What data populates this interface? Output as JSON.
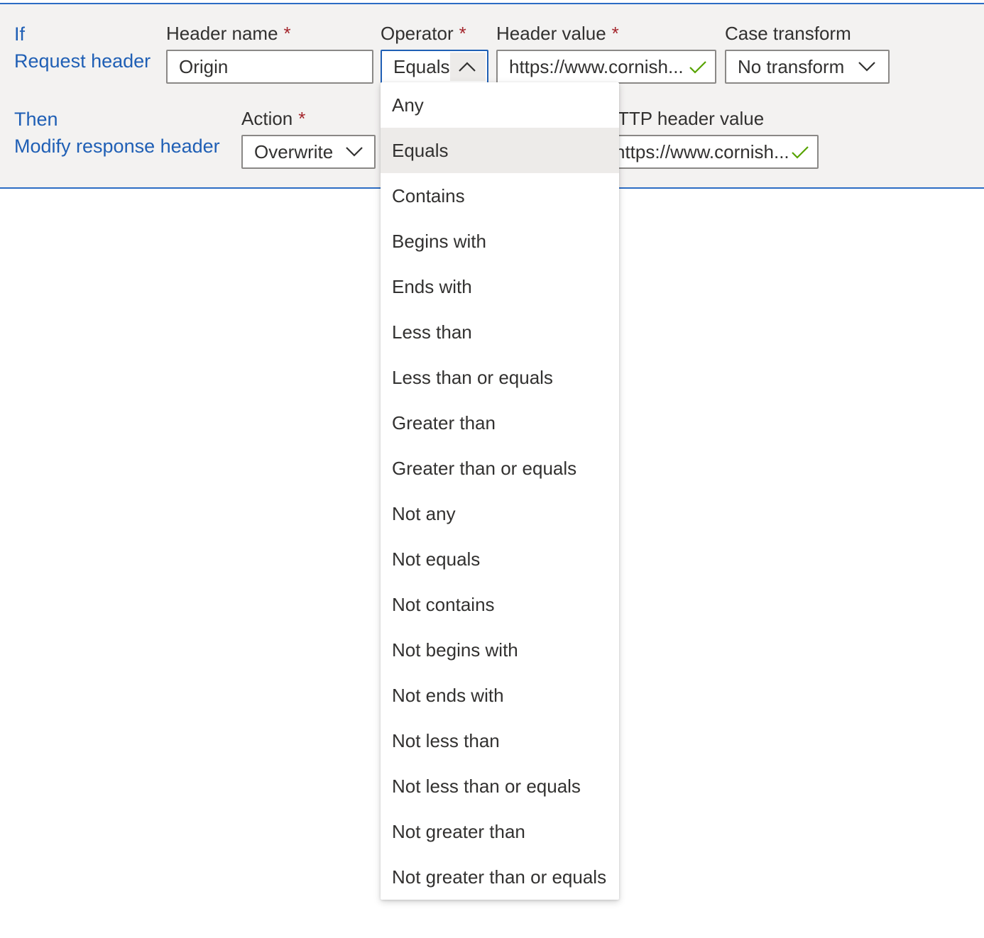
{
  "condition": {
    "keyword": "If",
    "type_label": "Request header",
    "header_name": {
      "label": "Header name",
      "required_mark": "*",
      "value": "Origin"
    },
    "operator": {
      "label": "Operator",
      "required_mark": "*",
      "value": "Equals"
    },
    "header_value": {
      "label": "Header value",
      "required_mark": "*",
      "value": "https://www.cornish..."
    },
    "case_transform": {
      "label": "Case transform",
      "value": "No transform"
    }
  },
  "action": {
    "keyword": "Then",
    "type_label": "Modify response header",
    "action_field": {
      "label": "Action",
      "required_mark": "*",
      "value": "Overwrite"
    },
    "http_header_value": {
      "label": "TTP header value",
      "value": "https://www.cornish..."
    }
  },
  "operator_dropdown": {
    "selected": "Equals",
    "options": [
      "Any",
      "Equals",
      "Contains",
      "Begins with",
      "Ends with",
      "Less than",
      "Less than or equals",
      "Greater than",
      "Greater than or equals",
      "Not any",
      "Not equals",
      "Not contains",
      "Not begins with",
      "Not ends with",
      "Not less than",
      "Not less than or equals",
      "Not greater than",
      "Not greater than or equals"
    ]
  },
  "colors": {
    "accent": "#1f5fb5",
    "required": "#a4262c",
    "valid_check": "#57a300",
    "panel_background": "#f3f2f1",
    "selected_option": "#edebe9"
  },
  "icons": {
    "dropdown_open": "chevron-up-icon",
    "dropdown_closed": "chevron-down-icon",
    "valid": "checkmark-icon"
  }
}
